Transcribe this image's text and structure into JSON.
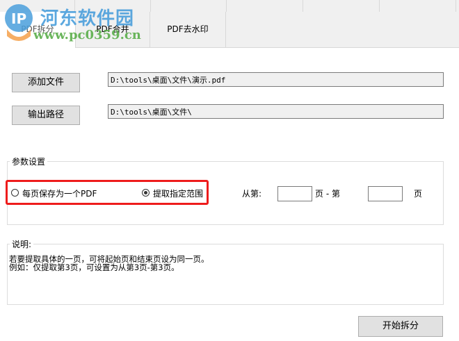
{
  "watermark": {
    "title": "河东软件园",
    "url": "www.pc0359.cn"
  },
  "tabs": [
    {
      "label": "PDF拆分"
    },
    {
      "label": "PDF合并"
    },
    {
      "label": "PDF去水印"
    }
  ],
  "add_file": {
    "label": "添加文件",
    "value": "D:\\tools\\桌面\\文件\\演示.pdf"
  },
  "output_path": {
    "label": "输出路径",
    "value": "D:\\tools\\桌面\\文件\\"
  },
  "params": {
    "title": "参数设置",
    "option1": "每页保存为一个PDF",
    "option2": "提取指定范围",
    "selected": "option2",
    "from_label": "从第:",
    "mid_label": "页 - 第",
    "end_label": "页",
    "from_value": "",
    "to_value": ""
  },
  "notes": {
    "title": "说明:",
    "line1": "若要提取具体的一页，可将起始页和结束页设为同一页。",
    "line2": "例如：仅提取第3页，可设置为从第3页-第3页。"
  },
  "start_button": "开始拆分",
  "colors": {
    "highlight": "#ee1c1c"
  }
}
